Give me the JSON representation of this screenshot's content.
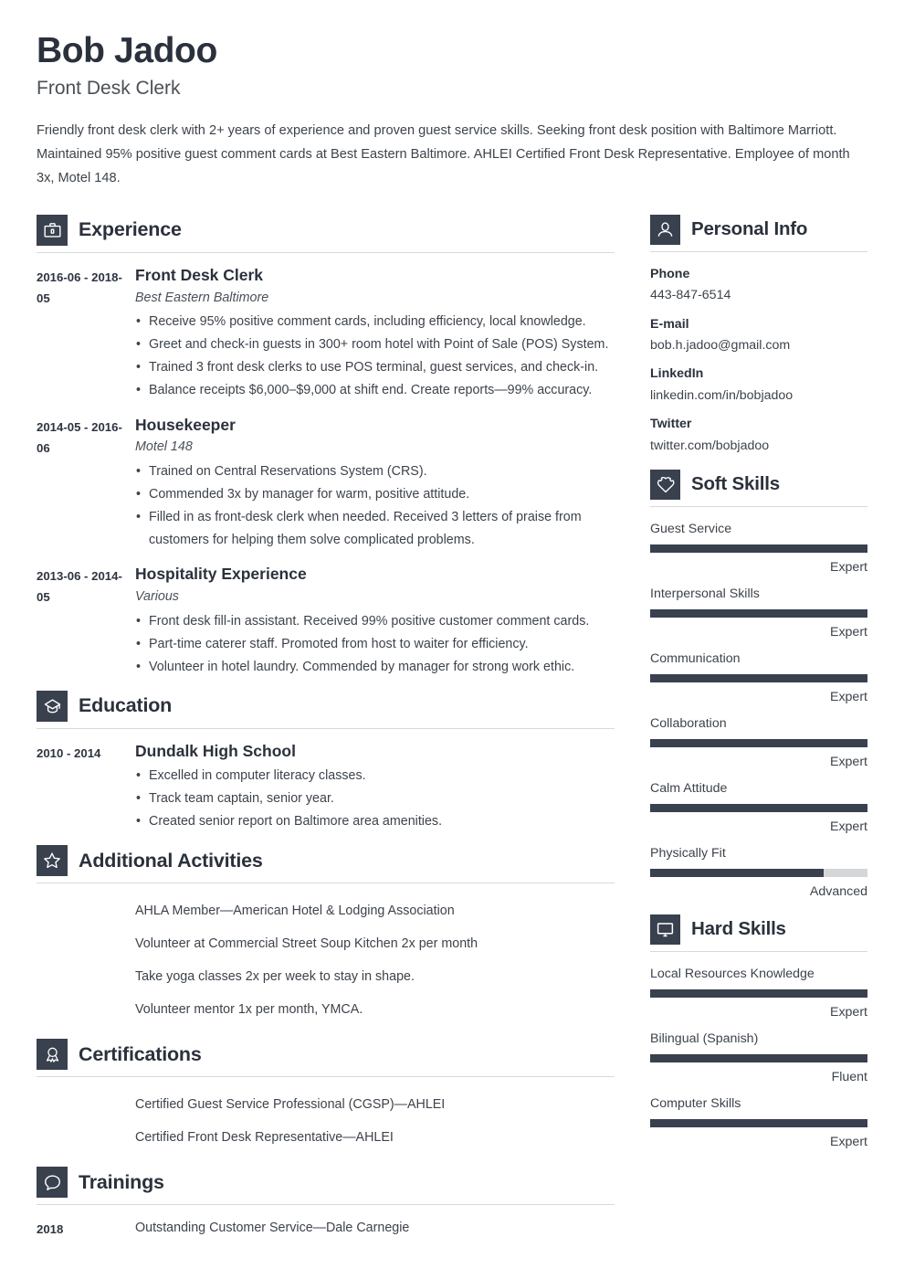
{
  "header": {
    "name": "Bob Jadoo",
    "job_title": "Front Desk Clerk",
    "summary": "Friendly front desk clerk with 2+ years of experience and proven guest service skills. Seeking front desk position with Baltimore Marriott. Maintained 95% positive guest comment cards at Best Eastern Baltimore. AHLEI Certified Front Desk Representative. Employee of month 3x, Motel 148."
  },
  "theme": {
    "accent": "#39404e",
    "heading": "#2b313c",
    "body_text": "#3d434b",
    "rule": "#d8d9dc",
    "track": "#d5d6d7"
  },
  "sections": {
    "experience": {
      "title": "Experience",
      "icon": "briefcase-icon",
      "entries": [
        {
          "date": "2016-06 - 2018-05",
          "role": "Front Desk Clerk",
          "org": "Best Eastern Baltimore",
          "bullets": [
            "Receive 95% positive comment cards, including efficiency, local knowledge.",
            "Greet and check-in guests in 300+ room hotel with Point of Sale (POS) System.",
            "Trained 3 front desk clerks to use POS terminal, guest services, and check-in.",
            "Balance receipts $6,000–$9,000 at shift end. Create reports—99% accuracy."
          ]
        },
        {
          "date": "2014-05 - 2016-06",
          "role": "Housekeeper",
          "org": "Motel 148",
          "bullets": [
            "Trained on Central Reservations System (CRS).",
            "Commended 3x by manager for warm, positive attitude.",
            "Filled in as front-desk clerk when needed. Received 3 letters of praise from customers for helping them solve complicated problems."
          ]
        },
        {
          "date": "2013-06 - 2014-05",
          "role": "Hospitality Experience",
          "org": "Various",
          "bullets": [
            "Front desk fill-in assistant. Received 99% positive customer comment cards.",
            "Part-time caterer staff. Promoted from host to waiter for efficiency.",
            "Volunteer in hotel laundry. Commended by manager for strong work ethic."
          ]
        }
      ]
    },
    "education": {
      "title": "Education",
      "icon": "graduation-cap-icon",
      "entries": [
        {
          "date": "2010 - 2014",
          "role": "Dundalk High School",
          "org": "",
          "bullets": [
            "Excelled in computer literacy classes.",
            "Track team captain, senior year.",
            "Created senior report on Baltimore area amenities."
          ]
        }
      ]
    },
    "additional_activities": {
      "title": "Additional Activities",
      "icon": "star-icon",
      "items": [
        "AHLA Member—American Hotel & Lodging Association",
        "Volunteer at Commercial Street Soup Kitchen 2x per month",
        "Take yoga classes 2x per week to stay in shape.",
        "Volunteer mentor 1x per month, YMCA."
      ]
    },
    "certifications": {
      "title": "Certifications",
      "icon": "award-ribbon-icon",
      "items": [
        "Certified Guest Service Professional (CGSP)—AHLEI",
        "Certified Front Desk Representative—AHLEI"
      ]
    },
    "trainings": {
      "title": "Trainings",
      "icon": "speech-bubble-icon",
      "entries": [
        {
          "date": "2018",
          "text": "Outstanding Customer Service—Dale Carnegie"
        }
      ]
    },
    "personal_info": {
      "title": "Personal Info",
      "icon": "person-icon",
      "fields": [
        {
          "label": "Phone",
          "value": "443-847-6514"
        },
        {
          "label": "E-mail",
          "value": "bob.h.jadoo@gmail.com"
        },
        {
          "label": "LinkedIn",
          "value": "linkedin.com/in/bobjadoo"
        },
        {
          "label": "Twitter",
          "value": "twitter.com/bobjadoo"
        }
      ]
    },
    "soft_skills": {
      "title": "Soft Skills",
      "icon": "heart-puzzle-icon",
      "skills": [
        {
          "name": "Guest Service",
          "level": "Expert",
          "percent": 100
        },
        {
          "name": "Interpersonal Skills",
          "level": "Expert",
          "percent": 100
        },
        {
          "name": "Communication",
          "level": "Expert",
          "percent": 100
        },
        {
          "name": "Collaboration",
          "level": "Expert",
          "percent": 100
        },
        {
          "name": "Calm Attitude",
          "level": "Expert",
          "percent": 100
        },
        {
          "name": "Physically Fit",
          "level": "Advanced",
          "percent": 80
        }
      ]
    },
    "hard_skills": {
      "title": "Hard Skills",
      "icon": "monitor-icon",
      "skills": [
        {
          "name": "Local Resources Knowledge",
          "level": "Expert",
          "percent": 100
        },
        {
          "name": "Bilingual (Spanish)",
          "level": "Fluent",
          "percent": 100
        },
        {
          "name": "Computer Skills",
          "level": "Expert",
          "percent": 100
        }
      ]
    }
  }
}
